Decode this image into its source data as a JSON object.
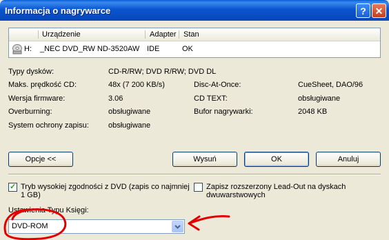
{
  "window": {
    "title": "Informacja o nagrywarce",
    "help_glyph": "?",
    "close_glyph": "✕"
  },
  "drive_list": {
    "columns": [
      "Urządzenie",
      "Adapter",
      "Stan"
    ],
    "rows": [
      {
        "letter": "H:",
        "device": "_NEC DVD_RW ND-3520AW",
        "adapter": "IDE",
        "status": "OK"
      }
    ]
  },
  "info": {
    "disc_types_label": "Typy dysków:",
    "disc_types_value": "CD-R/RW; DVD R/RW; DVD DL",
    "max_cd_speed_label": "Maks. prędkość CD:",
    "max_cd_speed_value": "48x (7 200 KB/s)",
    "firmware_label": "Wersja firmware:",
    "firmware_value": "3.06",
    "overburning_label": "Overburning:",
    "overburning_value": "obsługiwane",
    "protection_label": "System ochrony zapisu:",
    "protection_value": "obsługiwane",
    "dao_label": "Disc-At-Once:",
    "dao_value": "CueSheet, DAO/96",
    "cdtext_label": "CD TEXT:",
    "cdtext_value": "obsługiwane",
    "buffer_label": "Bufor nagrywarki:",
    "buffer_value": "2048 KB"
  },
  "buttons": {
    "options": "Opcje <<",
    "eject": "Wysuń",
    "ok": "OK",
    "cancel": "Anuluj"
  },
  "options": {
    "dvd_compat_label": "Tryb wysokiej zgodności z DVD (zapis co najmniej 1 GB)",
    "dvd_compat_checked": true,
    "leadout_label": "Zapisz rozszerzony Lead-Out na dyskach dwuwarstwowych",
    "leadout_checked": false,
    "booktype_label": "Ustawienia Typu Księgi:",
    "booktype_value": "DVD-ROM"
  },
  "colors": {
    "titlebar": "#0a55d0",
    "face": "#ece9d8",
    "annotation": "#e00000",
    "checkmark": "#21a121"
  }
}
